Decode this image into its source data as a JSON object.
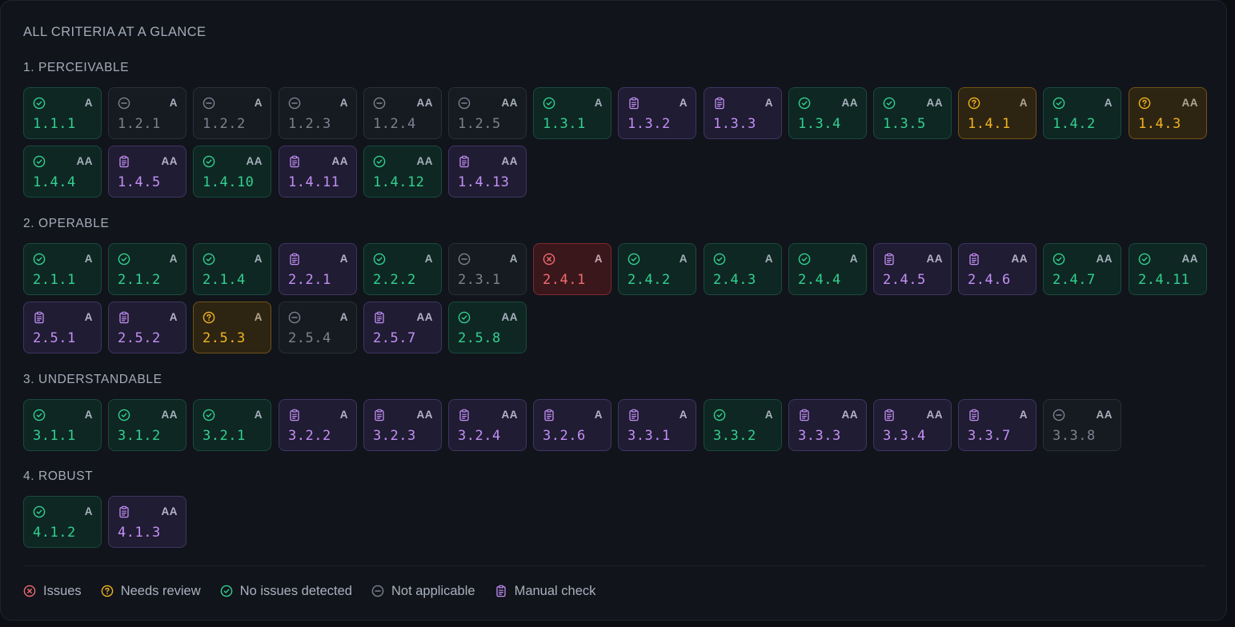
{
  "title": "ALL CRITERIA AT A GLANCE",
  "colors": {
    "pass": "#33d08f",
    "not_applicable": "#7b8390",
    "manual": "#c390f6",
    "review": "#f1b51f",
    "fail": "#f06b71"
  },
  "sections": [
    {
      "title": "1. PERCEIVABLE",
      "criteria": [
        {
          "id": "1.1.1",
          "level": "A",
          "status": "pass"
        },
        {
          "id": "1.2.1",
          "level": "A",
          "status": "na"
        },
        {
          "id": "1.2.2",
          "level": "A",
          "status": "na"
        },
        {
          "id": "1.2.3",
          "level": "A",
          "status": "na"
        },
        {
          "id": "1.2.4",
          "level": "AA",
          "status": "na"
        },
        {
          "id": "1.2.5",
          "level": "AA",
          "status": "na"
        },
        {
          "id": "1.3.1",
          "level": "A",
          "status": "pass"
        },
        {
          "id": "1.3.2",
          "level": "A",
          "status": "manual"
        },
        {
          "id": "1.3.3",
          "level": "A",
          "status": "manual"
        },
        {
          "id": "1.3.4",
          "level": "AA",
          "status": "pass"
        },
        {
          "id": "1.3.5",
          "level": "AA",
          "status": "pass"
        },
        {
          "id": "1.4.1",
          "level": "A",
          "status": "review"
        },
        {
          "id": "1.4.2",
          "level": "A",
          "status": "pass"
        },
        {
          "id": "1.4.3",
          "level": "AA",
          "status": "review"
        },
        {
          "id": "1.4.4",
          "level": "AA",
          "status": "pass"
        },
        {
          "id": "1.4.5",
          "level": "AA",
          "status": "manual"
        },
        {
          "id": "1.4.10",
          "level": "AA",
          "status": "pass"
        },
        {
          "id": "1.4.11",
          "level": "AA",
          "status": "manual"
        },
        {
          "id": "1.4.12",
          "level": "AA",
          "status": "pass"
        },
        {
          "id": "1.4.13",
          "level": "AA",
          "status": "manual"
        }
      ]
    },
    {
      "title": "2. OPERABLE",
      "criteria": [
        {
          "id": "2.1.1",
          "level": "A",
          "status": "pass"
        },
        {
          "id": "2.1.2",
          "level": "A",
          "status": "pass"
        },
        {
          "id": "2.1.4",
          "level": "A",
          "status": "pass"
        },
        {
          "id": "2.2.1",
          "level": "A",
          "status": "manual"
        },
        {
          "id": "2.2.2",
          "level": "A",
          "status": "pass"
        },
        {
          "id": "2.3.1",
          "level": "A",
          "status": "na"
        },
        {
          "id": "2.4.1",
          "level": "A",
          "status": "fail"
        },
        {
          "id": "2.4.2",
          "level": "A",
          "status": "pass"
        },
        {
          "id": "2.4.3",
          "level": "A",
          "status": "pass"
        },
        {
          "id": "2.4.4",
          "level": "A",
          "status": "pass"
        },
        {
          "id": "2.4.5",
          "level": "AA",
          "status": "manual"
        },
        {
          "id": "2.4.6",
          "level": "AA",
          "status": "manual"
        },
        {
          "id": "2.4.7",
          "level": "AA",
          "status": "pass"
        },
        {
          "id": "2.4.11",
          "level": "AA",
          "status": "pass"
        },
        {
          "id": "2.5.1",
          "level": "A",
          "status": "manual"
        },
        {
          "id": "2.5.2",
          "level": "A",
          "status": "manual"
        },
        {
          "id": "2.5.3",
          "level": "A",
          "status": "review"
        },
        {
          "id": "2.5.4",
          "level": "A",
          "status": "na"
        },
        {
          "id": "2.5.7",
          "level": "AA",
          "status": "manual"
        },
        {
          "id": "2.5.8",
          "level": "AA",
          "status": "pass"
        }
      ]
    },
    {
      "title": "3. UNDERSTANDABLE",
      "criteria": [
        {
          "id": "3.1.1",
          "level": "A",
          "status": "pass"
        },
        {
          "id": "3.1.2",
          "level": "AA",
          "status": "pass"
        },
        {
          "id": "3.2.1",
          "level": "A",
          "status": "pass"
        },
        {
          "id": "3.2.2",
          "level": "A",
          "status": "manual"
        },
        {
          "id": "3.2.3",
          "level": "AA",
          "status": "manual"
        },
        {
          "id": "3.2.4",
          "level": "AA",
          "status": "manual"
        },
        {
          "id": "3.2.6",
          "level": "A",
          "status": "manual"
        },
        {
          "id": "3.3.1",
          "level": "A",
          "status": "manual"
        },
        {
          "id": "3.3.2",
          "level": "A",
          "status": "pass"
        },
        {
          "id": "3.3.3",
          "level": "AA",
          "status": "manual"
        },
        {
          "id": "3.3.4",
          "level": "AA",
          "status": "manual"
        },
        {
          "id": "3.3.7",
          "level": "A",
          "status": "manual"
        },
        {
          "id": "3.3.8",
          "level": "AA",
          "status": "na"
        }
      ]
    },
    {
      "title": "4. ROBUST",
      "criteria": [
        {
          "id": "4.1.2",
          "level": "A",
          "status": "pass"
        },
        {
          "id": "4.1.3",
          "level": "AA",
          "status": "manual"
        }
      ]
    }
  ],
  "legend": [
    {
      "status": "fail",
      "icon": "x-circle-icon",
      "label": "Issues"
    },
    {
      "status": "review",
      "icon": "question-circle-icon",
      "label": "Needs review"
    },
    {
      "status": "pass",
      "icon": "check-circle-icon",
      "label": "No issues detected"
    },
    {
      "status": "na",
      "icon": "minus-circle-icon",
      "label": "Not applicable"
    },
    {
      "status": "manual",
      "icon": "clipboard-icon",
      "label": "Manual check"
    }
  ]
}
